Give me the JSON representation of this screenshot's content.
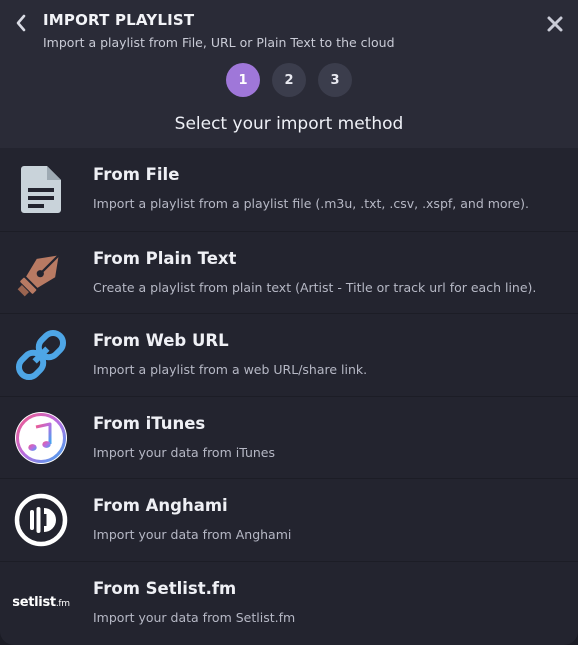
{
  "header": {
    "title": "IMPORT PLAYLIST",
    "subtitle": "Import a playlist from File, URL or Plain Text to the cloud"
  },
  "steps": [
    "1",
    "2",
    "3"
  ],
  "active_step": 1,
  "section_title": "Select your import method",
  "methods": [
    {
      "name": "From File",
      "desc": "Import a playlist from a playlist file (.m3u, .txt, .csv, .xspf, and more).",
      "icon": "file-icon"
    },
    {
      "name": "From Plain Text",
      "desc": "Create a playlist from plain text (Artist - Title or track url for each line).",
      "icon": "fountain-pen-icon"
    },
    {
      "name": "From Web URL",
      "desc": "Import a playlist from a web URL/share link.",
      "icon": "link-icon"
    },
    {
      "name": "From iTunes",
      "desc": "Import your data from iTunes",
      "icon": "itunes-icon"
    },
    {
      "name": "From Anghami",
      "desc": "Import your data from Anghami",
      "icon": "anghami-icon"
    },
    {
      "name": "From Setlist.fm",
      "desc": "Import your data from Setlist.fm",
      "icon": "setlist-fm-icon"
    }
  ],
  "setlist_logo": {
    "main": "setlist",
    "suffix": ".fm"
  },
  "colors": {
    "accent": "#9f77d9",
    "background": "#23242f",
    "header": "#2a2b37"
  }
}
